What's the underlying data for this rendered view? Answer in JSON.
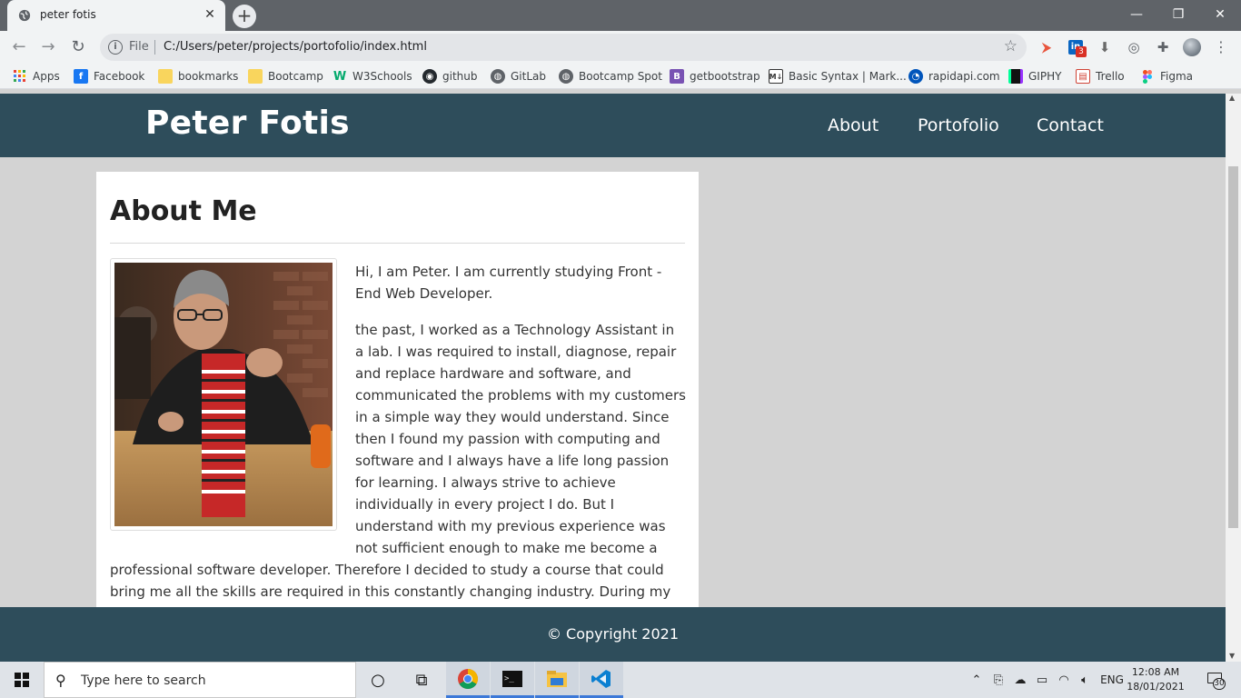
{
  "browser": {
    "tab_title": "peter fotis",
    "tab_close": "✕",
    "new_tab": "+",
    "window_controls": [
      "—",
      "❐",
      "✕"
    ],
    "omnibox": {
      "scheme_label": "File",
      "url": "C:/Users/peter/projects/portofolio/index.html"
    },
    "extension_badge": "3",
    "bookmarks": [
      {
        "label": "Apps",
        "icon": "apps-grid-icon",
        "color": "#e94235"
      },
      {
        "label": "Facebook",
        "icon": "facebook-icon",
        "color": "#1877f2"
      },
      {
        "label": "bookmarks",
        "icon": "folder-icon",
        "color": "#f9d55d"
      },
      {
        "label": "Bootcamp",
        "icon": "folder-icon",
        "color": "#f9d55d"
      },
      {
        "label": "W3Schools",
        "icon": "w3schools-icon",
        "color": "#04aa6d"
      },
      {
        "label": "github",
        "icon": "github-icon",
        "color": "#24292e"
      },
      {
        "label": "GitLab",
        "icon": "globe-icon",
        "color": "#5f6368"
      },
      {
        "label": "Bootcamp Spot",
        "icon": "globe-icon",
        "color": "#5f6368"
      },
      {
        "label": "getbootstrap",
        "icon": "bootstrap-icon",
        "color": "#7952b3"
      },
      {
        "label": "Basic Syntax | Mark...",
        "icon": "markdown-icon",
        "color": "#333333"
      },
      {
        "label": "rapidapi.com",
        "icon": "rapidapi-icon",
        "color": "#0055bb"
      },
      {
        "label": "GIPHY",
        "icon": "giphy-icon",
        "color": "#111111"
      },
      {
        "label": "Trello",
        "icon": "trello-icon",
        "color": "#d04437"
      },
      {
        "label": "Figma",
        "icon": "figma-icon",
        "color": "#f24e1e"
      }
    ]
  },
  "site": {
    "logo": "Peter Fotis",
    "nav": [
      "About",
      "Portofolio",
      "Contact"
    ],
    "about": {
      "title": "About Me",
      "paragraphs": [
        "Hi, I am Peter. I am currently studying Front -End Web Developer.",
        "the past, I worked as a Technology Assistant in a lab. I was required to install, diagnose, repair and replace hardware and software, and communicated the problems with my customers in a simple way they would understand. Since then I found my passion with computing and software and I always have a life long passion for learning. I always strive to achieve individually in every project I do. But I understand with my previous experience was not sufficient enough to make me become a professional software developer. Therefore I decided to study a course that could bring me all the skills are required in this constantly changing industry. During my study, I was not afraid of tacking unknown problems or"
      ]
    },
    "footer": "© Copyright 2021"
  },
  "taskbar": {
    "search_placeholder": "Type here to search",
    "language": "ENG",
    "time": "12:08 AM",
    "date": "18/01/2021",
    "notification_count": "30"
  },
  "colors": {
    "header_bg": "#2e4d5b",
    "page_bg": "#d3d3d3"
  }
}
